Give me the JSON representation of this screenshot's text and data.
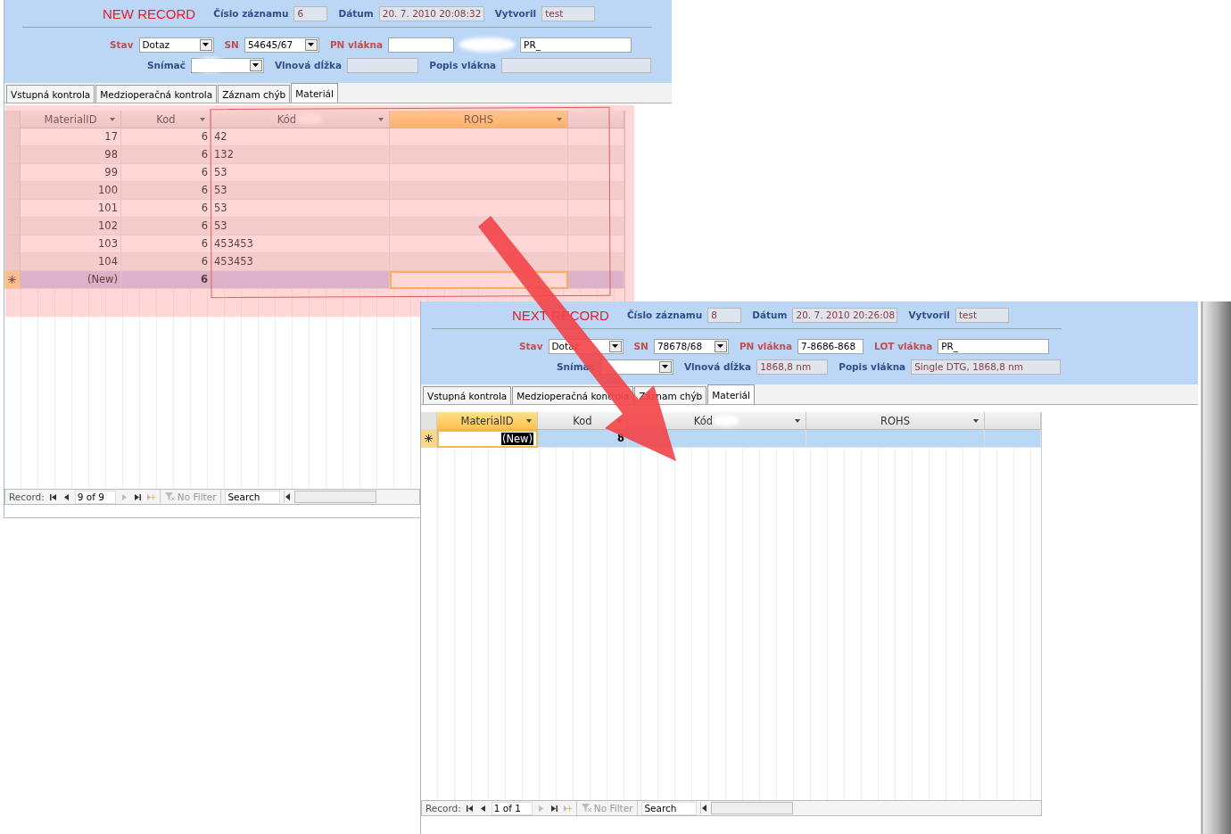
{
  "forms": [
    {
      "title": "NEW RECORD",
      "highlighted": true,
      "header": [
        {
          "label": "Číslo záznamu",
          "value": "6"
        },
        {
          "label": "Dátum",
          "value": "20. 7. 2010 20:08:32"
        },
        {
          "label": "Vytvoril",
          "value": "test"
        }
      ],
      "row1": [
        {
          "label": "Stav",
          "required": true,
          "kind": "combo",
          "value": "Dotaz"
        },
        {
          "label": "SN",
          "required": true,
          "kind": "combo",
          "value": "54645/67"
        },
        {
          "label": "PN vlákna",
          "required": true,
          "kind": "text"
        },
        {
          "label_redacted": true,
          "required": true,
          "kind": "text",
          "value": "PR_"
        }
      ],
      "row2": [
        {
          "label": "Snímač",
          "required": false,
          "kind": "combo",
          "value_redacted": true
        },
        {
          "label": "Vlnová dĺžka",
          "required": false,
          "kind": "readonly"
        },
        {
          "label": "Popis vlákna",
          "required": false,
          "kind": "readonly"
        }
      ],
      "tabs": [
        {
          "label": "Vstupná kontrola",
          "selected": false
        },
        {
          "label": "Medzioperačná kontrola",
          "selected": false
        },
        {
          "label": "Záznam chýb",
          "selected": false
        },
        {
          "label": "Materiál",
          "selected": true
        }
      ],
      "columns": [
        {
          "label": "MaterialID",
          "selected": false
        },
        {
          "label": "Kod",
          "selected": false
        },
        {
          "label": "Kód",
          "selected": false,
          "redacted_suffix": true
        },
        {
          "label": "ROHS",
          "selected": true
        }
      ],
      "rows": [
        {
          "kind": "record",
          "cells": [
            "17",
            "6",
            "42"
          ]
        },
        {
          "kind": "record",
          "cells": [
            "98",
            "6",
            "132"
          ]
        },
        {
          "kind": "record",
          "cells": [
            "99",
            "6",
            "53"
          ]
        },
        {
          "kind": "record",
          "cells": [
            "100",
            "6",
            "53"
          ]
        },
        {
          "kind": "record",
          "cells": [
            "101",
            "6",
            "53"
          ]
        },
        {
          "kind": "record",
          "cells": [
            "102",
            "6",
            "53"
          ]
        },
        {
          "kind": "record",
          "cells": [
            "103",
            "6",
            "453453"
          ]
        },
        {
          "kind": "record",
          "cells": [
            "104",
            "6",
            "453453"
          ]
        },
        {
          "kind": "new",
          "cells": [
            "(New)",
            "6"
          ]
        }
      ],
      "nav": {
        "label": "Record:",
        "position": "9 of 9",
        "filter": "No Filter",
        "search": "Search"
      }
    },
    {
      "title": "NEXT RECORD",
      "highlighted": false,
      "header": [
        {
          "label": "Číslo záznamu",
          "value": "8"
        },
        {
          "label": "Dátum",
          "value": "20. 7. 2010 20:26:08"
        },
        {
          "label": "Vytvoril",
          "value": "test"
        }
      ],
      "row1": [
        {
          "label": "Stav",
          "required": true,
          "kind": "combo",
          "value": "Dotaz"
        },
        {
          "label": "SN",
          "required": true,
          "kind": "combo",
          "value": "78678/68"
        },
        {
          "label": "PN vlákna",
          "required": true,
          "kind": "text",
          "value": "7-8686-868"
        },
        {
          "label": "LOT vlákna",
          "required": true,
          "kind": "text",
          "value": "PR_"
        }
      ],
      "row2": [
        {
          "label": "Snímač",
          "required": false,
          "kind": "combo"
        },
        {
          "label": "Vlnová dĺžka",
          "required": false,
          "kind": "readonly",
          "value": "1868,8 nm"
        },
        {
          "label": "Popis vlákna",
          "required": false,
          "kind": "readonly",
          "value": "Single DTG, 1868,8 nm"
        }
      ],
      "tabs": [
        {
          "label": "Vstupná kontrola",
          "selected": false
        },
        {
          "label": "Medzioperačná kontrola",
          "selected": false
        },
        {
          "label": "Záznam chýb",
          "selected": false
        },
        {
          "label": "Materiál",
          "selected": true
        }
      ],
      "columns": [
        {
          "label": "MaterialID",
          "selected": true
        },
        {
          "label": "Kod",
          "selected": false
        },
        {
          "label": "Kód",
          "selected": false,
          "redacted_suffix": true
        },
        {
          "label": "ROHS",
          "selected": false
        }
      ],
      "rows": [
        {
          "kind": "new",
          "cells": [
            "(New)",
            "8"
          ]
        }
      ],
      "nav": {
        "label": "Record:",
        "position": "1 of 1",
        "filter": "No Filter",
        "search": "Search"
      }
    }
  ]
}
